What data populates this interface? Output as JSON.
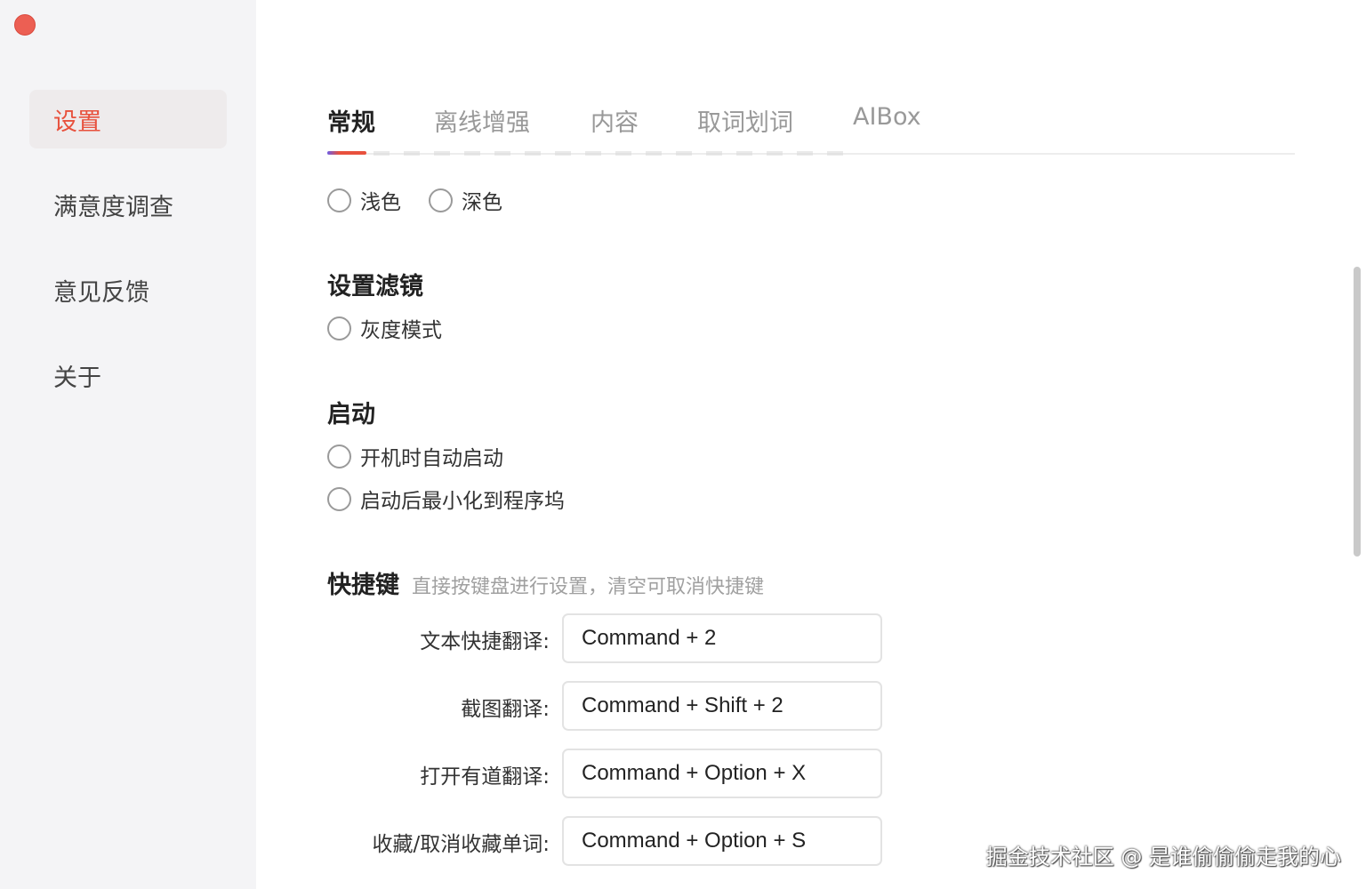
{
  "sidebar": {
    "items": [
      {
        "label": "设置",
        "active": true
      },
      {
        "label": "满意度调查",
        "active": false
      },
      {
        "label": "意见反馈",
        "active": false
      },
      {
        "label": "关于",
        "active": false
      }
    ]
  },
  "tabs": [
    {
      "label": "常规",
      "active": true
    },
    {
      "label": "离线增强",
      "active": false
    },
    {
      "label": "内容",
      "active": false
    },
    {
      "label": "取词划词",
      "active": false
    },
    {
      "label": "AIBox",
      "active": false
    }
  ],
  "theme": {
    "options": [
      {
        "label": "浅色",
        "checked": false
      },
      {
        "label": "深色",
        "checked": false
      }
    ]
  },
  "filter": {
    "title": "设置滤镜",
    "options": [
      {
        "label": "灰度模式",
        "checked": false
      }
    ]
  },
  "startup": {
    "title": "启动",
    "options": [
      {
        "label": "开机时自动启动",
        "checked": false
      },
      {
        "label": "启动后最小化到程序坞",
        "checked": false
      }
    ]
  },
  "shortcuts": {
    "title": "快捷键",
    "hint": "直接按键盘进行设置，清空可取消快捷键",
    "items": [
      {
        "label": "文本快捷翻译:",
        "value": "Command + 2"
      },
      {
        "label": "截图翻译:",
        "value": "Command + Shift + 2"
      },
      {
        "label": "打开有道翻译:",
        "value": "Command + Option + X"
      },
      {
        "label": "收藏/取消收藏单词:",
        "value": "Command + Option + S"
      }
    ]
  },
  "watermark": "掘金技术社区 @ 是谁偷偷偷走我的心",
  "colors": {
    "accent": "#e8513d",
    "close_button": "#ec5f53",
    "sidebar_bg": "#f4f4f6"
  }
}
